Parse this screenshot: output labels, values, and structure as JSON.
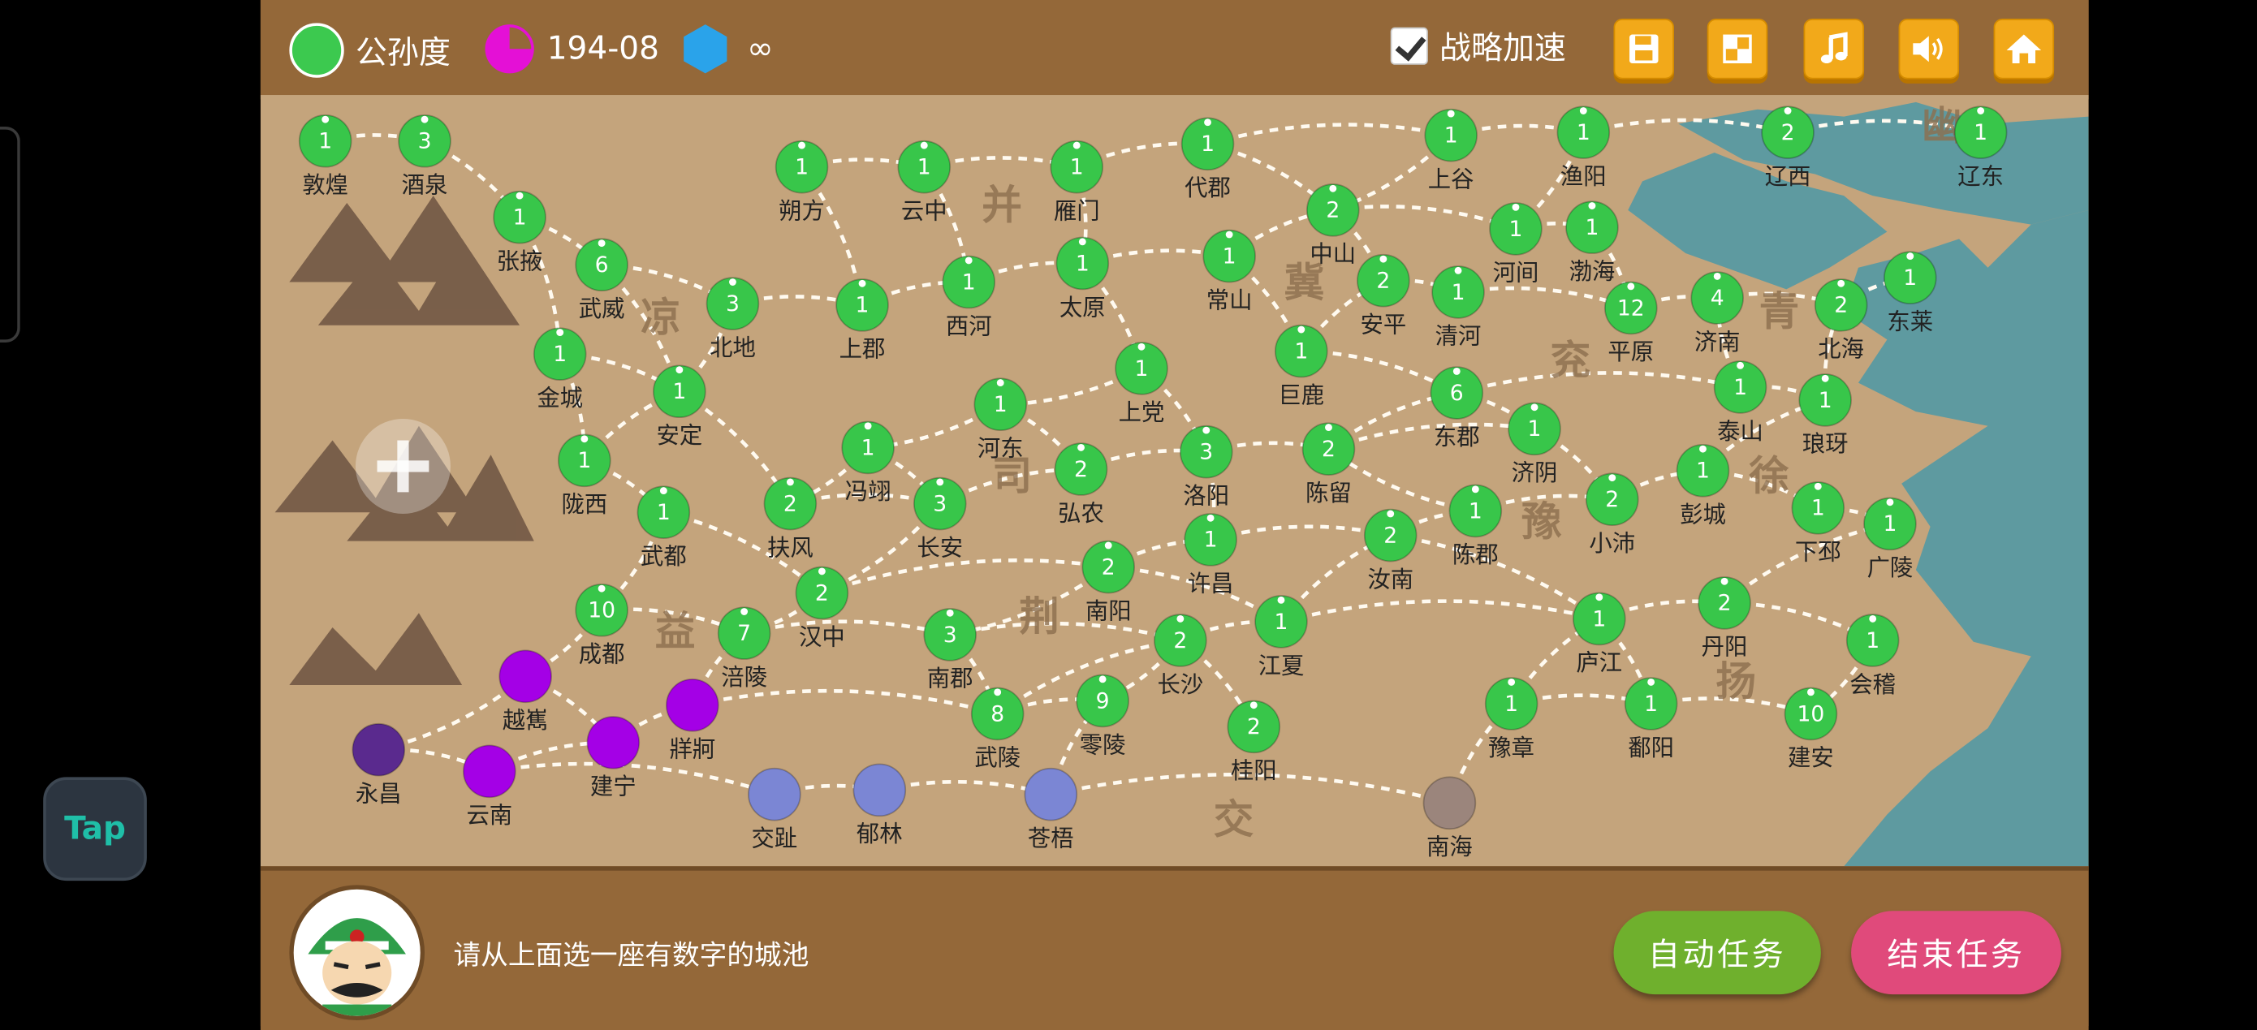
{
  "hud": {
    "player_name": "公孙度",
    "player_color": "#3cc94f",
    "date": "194-08",
    "date_color": "#e410d6",
    "resource_value": "∞",
    "resource_color": "#2aa3ea",
    "strategy_speed_label": "战略加速",
    "strategy_speed_checked": true,
    "buttons": [
      "save-icon",
      "layout-icon",
      "music-icon",
      "volume-icon",
      "home-icon"
    ]
  },
  "side": {
    "tap_label": "Tap",
    "zoom_icon": "plus-icon"
  },
  "colors": {
    "own_city": "#38c64a",
    "enemy_purple": "#a400e6",
    "enemy_darkpurple": "#5a2a8e",
    "enemy_blue": "#7b86d4",
    "enemy_gray": "#9b857c",
    "sea": "#5e9aa0",
    "land": "#c4a47c"
  },
  "regions": [
    "幽",
    "并",
    "冀",
    "凉",
    "兖",
    "青",
    "司",
    "徐",
    "豫",
    "益",
    "荆",
    "扬",
    "交"
  ],
  "cities": [
    {
      "name": "敦煌",
      "value": "1",
      "faction": "own"
    },
    {
      "name": "酒泉",
      "value": "3",
      "faction": "own"
    },
    {
      "name": "张掖",
      "value": "1",
      "faction": "own"
    },
    {
      "name": "武威",
      "value": "6",
      "faction": "own"
    },
    {
      "name": "北地",
      "value": "3",
      "faction": "own"
    },
    {
      "name": "金城",
      "value": "1",
      "faction": "own"
    },
    {
      "name": "安定",
      "value": "1",
      "faction": "own"
    },
    {
      "name": "陇西",
      "value": "1",
      "faction": "own"
    },
    {
      "name": "武都",
      "value": "1",
      "faction": "own"
    },
    {
      "name": "朔方",
      "value": "1",
      "faction": "own"
    },
    {
      "name": "云中",
      "value": "1",
      "faction": "own"
    },
    {
      "name": "雁门",
      "value": "1",
      "faction": "own"
    },
    {
      "name": "代郡",
      "value": "1",
      "faction": "own"
    },
    {
      "name": "上谷",
      "value": "1",
      "faction": "own"
    },
    {
      "name": "渔阳",
      "value": "1",
      "faction": "own"
    },
    {
      "name": "辽西",
      "value": "2",
      "faction": "own"
    },
    {
      "name": "辽东",
      "value": "1",
      "faction": "own"
    },
    {
      "name": "上郡",
      "value": "1",
      "faction": "own"
    },
    {
      "name": "西河",
      "value": "1",
      "faction": "own"
    },
    {
      "name": "太原",
      "value": "1",
      "faction": "own"
    },
    {
      "name": "常山",
      "value": "1",
      "faction": "own"
    },
    {
      "name": "中山",
      "value": "2",
      "faction": "own"
    },
    {
      "name": "安平",
      "value": "2",
      "faction": "own"
    },
    {
      "name": "河间",
      "value": "1",
      "faction": "own"
    },
    {
      "name": "渤海",
      "value": "1",
      "faction": "own"
    },
    {
      "name": "清河",
      "value": "1",
      "faction": "own"
    },
    {
      "name": "平原",
      "value": "12",
      "faction": "own"
    },
    {
      "name": "济南",
      "value": "4",
      "faction": "own"
    },
    {
      "name": "北海",
      "value": "2",
      "faction": "own"
    },
    {
      "name": "东莱",
      "value": "1",
      "faction": "own"
    },
    {
      "name": "上党",
      "value": "1",
      "faction": "own"
    },
    {
      "name": "巨鹿",
      "value": "1",
      "faction": "own"
    },
    {
      "name": "东郡",
      "value": "6",
      "faction": "own"
    },
    {
      "name": "泰山",
      "value": "1",
      "faction": "own"
    },
    {
      "name": "琅玡",
      "value": "1",
      "faction": "own"
    },
    {
      "name": "河东",
      "value": "1",
      "faction": "own"
    },
    {
      "name": "冯翊",
      "value": "1",
      "faction": "own"
    },
    {
      "name": "弘农",
      "value": "2",
      "faction": "own"
    },
    {
      "name": "洛阳",
      "value": "3",
      "faction": "own"
    },
    {
      "name": "陈留",
      "value": "2",
      "faction": "own"
    },
    {
      "name": "济阴",
      "value": "1",
      "faction": "own"
    },
    {
      "name": "彭城",
      "value": "1",
      "faction": "own"
    },
    {
      "name": "扶风",
      "value": "2",
      "faction": "own"
    },
    {
      "name": "长安",
      "value": "3",
      "faction": "own"
    },
    {
      "name": "许昌",
      "value": "1",
      "faction": "own"
    },
    {
      "name": "汝南",
      "value": "2",
      "faction": "own"
    },
    {
      "name": "陈郡",
      "value": "1",
      "faction": "own"
    },
    {
      "name": "小沛",
      "value": "2",
      "faction": "own"
    },
    {
      "name": "下邳",
      "value": "1",
      "faction": "own"
    },
    {
      "name": "广陵",
      "value": "1",
      "faction": "own"
    },
    {
      "name": "成都",
      "value": "10",
      "faction": "own"
    },
    {
      "name": "汉中",
      "value": "2",
      "faction": "own"
    },
    {
      "name": "南阳",
      "value": "2",
      "faction": "own"
    },
    {
      "name": "涪陵",
      "value": "7",
      "faction": "own"
    },
    {
      "name": "南郡",
      "value": "3",
      "faction": "own"
    },
    {
      "name": "长沙",
      "value": "2",
      "faction": "own"
    },
    {
      "name": "江夏",
      "value": "1",
      "faction": "own"
    },
    {
      "name": "庐江",
      "value": "1",
      "faction": "own"
    },
    {
      "name": "丹阳",
      "value": "2",
      "faction": "own"
    },
    {
      "name": "会稽",
      "value": "1",
      "faction": "own"
    },
    {
      "name": "武陵",
      "value": "8",
      "faction": "own"
    },
    {
      "name": "零陵",
      "value": "9",
      "faction": "own"
    },
    {
      "name": "桂阳",
      "value": "2",
      "faction": "own"
    },
    {
      "name": "豫章",
      "value": "1",
      "faction": "own"
    },
    {
      "name": "鄱阳",
      "value": "1",
      "faction": "own"
    },
    {
      "name": "建安",
      "value": "10",
      "faction": "own"
    },
    {
      "name": "越嶲",
      "value": "",
      "faction": "purple"
    },
    {
      "name": "牂牁",
      "value": "",
      "faction": "purple"
    },
    {
      "name": "建宁",
      "value": "",
      "faction": "purple"
    },
    {
      "name": "云南",
      "value": "",
      "faction": "purple"
    },
    {
      "name": "永昌",
      "value": "",
      "faction": "darkpurple"
    },
    {
      "name": "交趾",
      "value": "",
      "faction": "blue"
    },
    {
      "name": "郁林",
      "value": "",
      "faction": "blue"
    },
    {
      "name": "苍梧",
      "value": "",
      "faction": "blue"
    },
    {
      "name": "南海",
      "value": "",
      "faction": "gray"
    }
  ],
  "bottom": {
    "avatar": "general-portrait",
    "instruction": "请从上面选一座有数字的城池",
    "auto_task_label": "自动任务",
    "end_task_label": "结束任务"
  }
}
